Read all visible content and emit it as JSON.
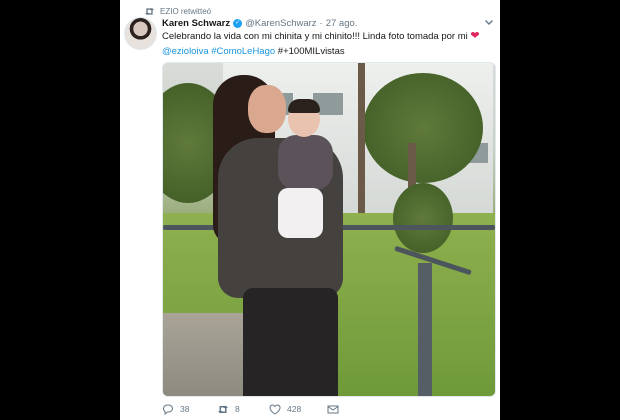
{
  "retweet": {
    "text": "EZIO retwitteó"
  },
  "tweet": {
    "name": "Karen Schwarz",
    "handle": "@KarenSchwarz",
    "separator": "·",
    "date": "27 ago.",
    "line1": "Celebrando la vida con mi chinita y mi chinito!!! Linda foto tomada por mi",
    "mention": "@ezioloiva",
    "hashtag": "#ComoLeHago",
    "tags_rest": "#+100MILvistas"
  },
  "actions": {
    "replies": "38",
    "retweets": "8",
    "likes": "428"
  },
  "colors": {
    "link": "#1b95e0",
    "verified": "#1da1f2",
    "heart": "#e0245e",
    "muted": "#657786"
  },
  "icons": [
    "retweet-icon",
    "verified-icon",
    "chevron-down-icon",
    "heart-icon",
    "reply-icon",
    "like-icon",
    "message-icon"
  ]
}
